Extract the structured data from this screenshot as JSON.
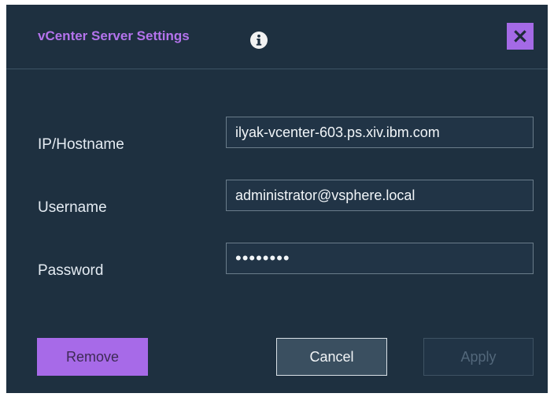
{
  "dialog": {
    "title": "vCenter Server Settings",
    "info_icon": "info-icon",
    "close_icon": "close-icon",
    "accent_color": "#a76ae8",
    "background_color": "#1e3040"
  },
  "form": {
    "fields": [
      {
        "label": "IP/Hostname",
        "value": "ilyak-vcenter-603.ps.xiv.ibm.com"
      },
      {
        "label": "Username",
        "value": "administrator@vsphere.local"
      },
      {
        "label": "Password",
        "value": "••••••••"
      }
    ]
  },
  "buttons": {
    "remove": "Remove",
    "cancel": "Cancel",
    "apply": "Apply",
    "apply_disabled": true
  }
}
